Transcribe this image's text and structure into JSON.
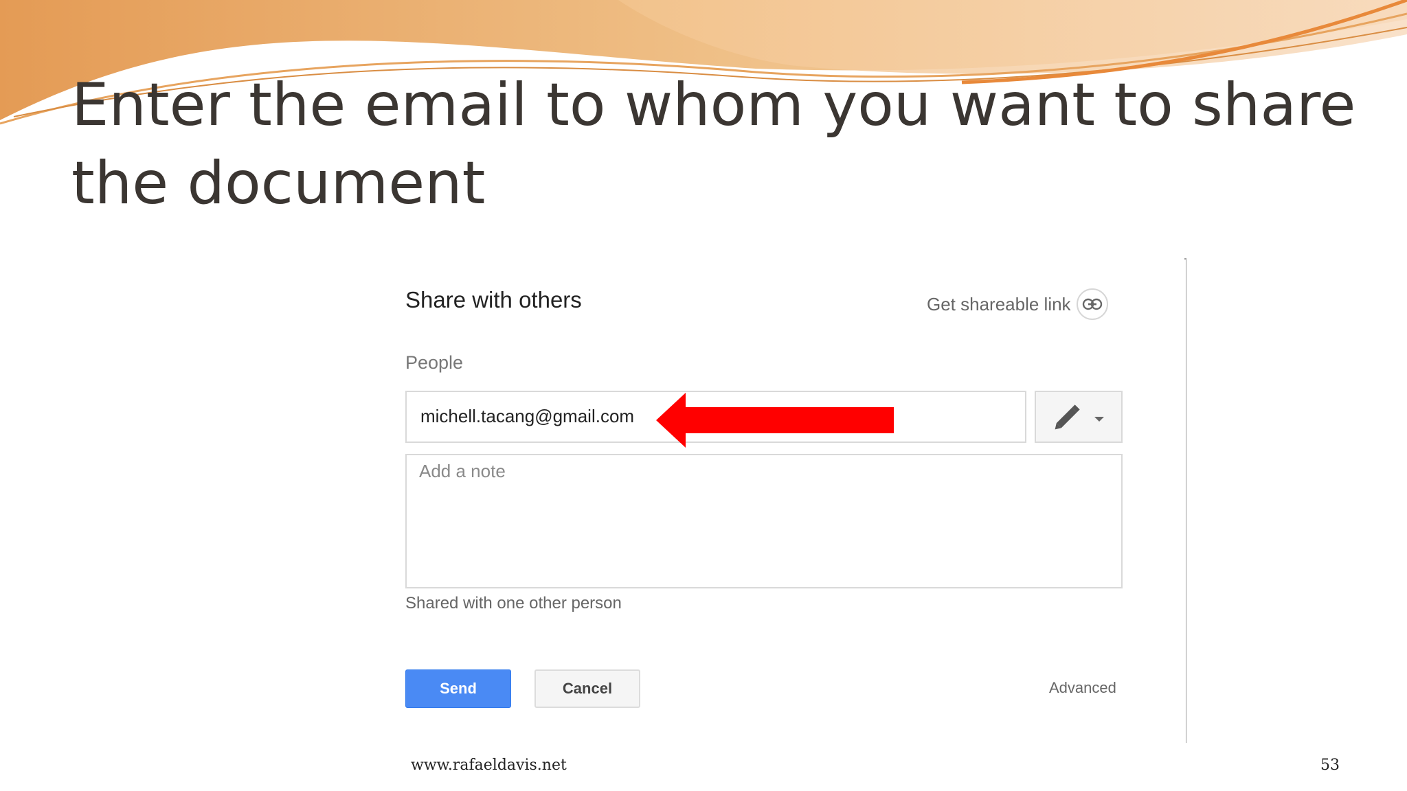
{
  "slide": {
    "title": "Enter the email to whom you want to share the document",
    "footer_url": "www.rafaeldavis.net",
    "page_number": "53"
  },
  "dialog": {
    "title": "Share with others",
    "get_link_label": "Get shareable link",
    "people_label": "People",
    "email_value": "michell.tacang@gmail.com",
    "note_placeholder": "Add a note",
    "shared_status": "Shared with one other person",
    "send_label": "Send",
    "cancel_label": "Cancel",
    "advanced_label": "Advanced",
    "link_icon": "link-icon",
    "permission_icon": "pencil-icon"
  },
  "colors": {
    "send_button": "#4a8af4",
    "annotation_arrow": "#ff0000",
    "banner_orange": "#e8a35a"
  }
}
